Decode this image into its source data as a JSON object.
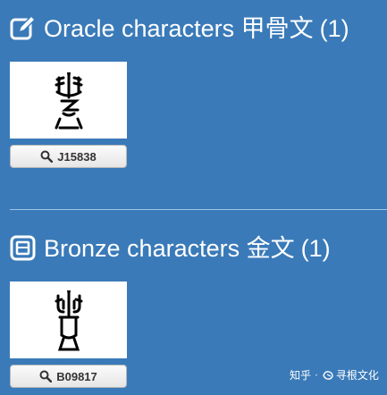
{
  "oracle": {
    "title": "Oracle characters 甲骨文",
    "count": "(1)",
    "icon": "edit-icon",
    "items": [
      {
        "id": "J15838",
        "icon": "search-icon"
      }
    ]
  },
  "bronze": {
    "title": "Bronze characters 金文",
    "count": "(1)",
    "icon": "bronze-square-icon",
    "items": [
      {
        "id": "B09817",
        "icon": "search-icon"
      }
    ]
  },
  "watermark": {
    "site": "知乎",
    "author": "寻根文化"
  },
  "colors": {
    "background": "#3a7ab8",
    "text": "#ffffff",
    "button_text": "#333333"
  }
}
